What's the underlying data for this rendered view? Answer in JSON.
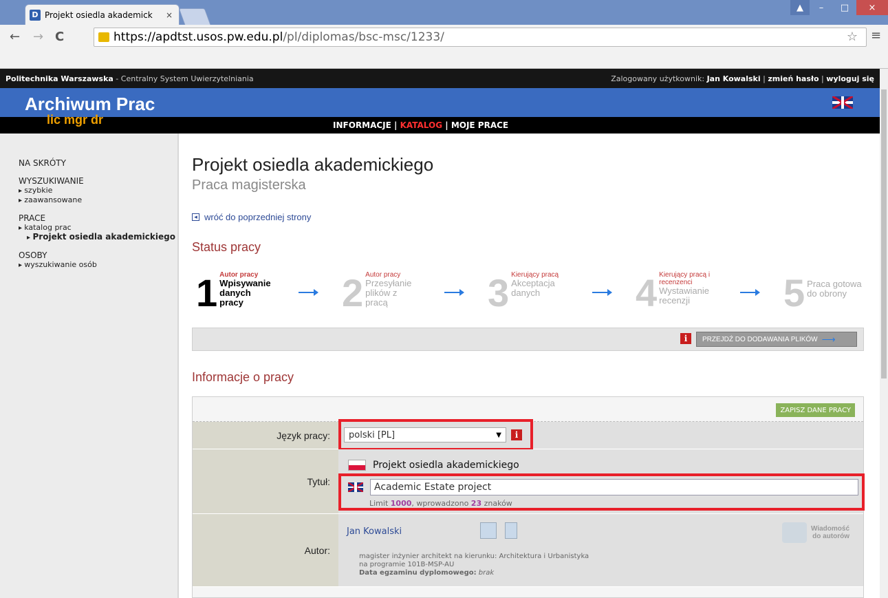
{
  "browser": {
    "tab_title": "Projekt osiedla akademick",
    "tab_close": "×",
    "favicon": "D",
    "url_host": "https://apdtst.usos.pw.edu.pl",
    "url_path": "/pl/diplomas/bsc-msc/1233/",
    "back": "←",
    "forward": "→",
    "reload": "C",
    "star": "☆",
    "menu": "≡",
    "minimize": "–",
    "maximize": "□",
    "close": "×",
    "user": "▲"
  },
  "site": {
    "org": "Politechnika Warszawska",
    "system": " - Centralny System Uwierzytelniania",
    "logged_label": "Zalogowany użytkownik: ",
    "user": "Jan Kowalski",
    "change_pw": "zmień hasło",
    "logout": "wyloguj się",
    "sep": " | ",
    "title": "Archiwum Prac",
    "degrees": "lic mgr dr",
    "nav": {
      "info": "INFORMACJE",
      "catalog": "KATALOG",
      "mine": "MOJE PRACE",
      "sep": " | "
    }
  },
  "sidebar": {
    "shortcuts": "NA SKRÓTY",
    "search": "WYSZUKIWANIE",
    "search_items": [
      "szybkie",
      "zaawansowane"
    ],
    "works": "PRACE",
    "works_items": [
      "katalog prac"
    ],
    "works_sub": "Projekt osiedla akademickiego",
    "people": "OSOBY",
    "people_items": [
      "wyszukiwanie osób"
    ]
  },
  "main": {
    "title": "Projekt osiedla akademickiego",
    "subtitle": "Praca magisterska",
    "back": "wróć do poprzedniej strony",
    "status_title": "Status pracy",
    "info_title": "Informacje o pracy",
    "go_button": "PRZEJDŹ DO DODAWANIA PLIKÓW",
    "info_icon": "i"
  },
  "steps": [
    {
      "num": "1",
      "role": "Autor pracy",
      "act": "Wpisywanie danych pracy",
      "active": true
    },
    {
      "num": "2",
      "role": "Autor pracy",
      "act": "Przesyłanie plików z pracą",
      "active": false
    },
    {
      "num": "3",
      "role": "Kierujący pracą",
      "act": "Akceptacja danych",
      "active": false
    },
    {
      "num": "4",
      "role": "Kierujący pracą i recenzenci",
      "act": "Wystawianie recenzji",
      "active": false
    },
    {
      "num": "5",
      "role": "",
      "act": "Praca gotowa do obrony",
      "active": false
    }
  ],
  "form": {
    "save": "ZAPISZ DANE PRACY",
    "lang_label": "Język pracy:",
    "lang_value": "polski [PL]",
    "title_label": "Tytuł:",
    "title_pl": "Projekt osiedla akademickiego",
    "title_en": "Academic Estate project",
    "limit_pre": "Limit ",
    "limit_max": "1000",
    "limit_mid": ", wprowadzono ",
    "limit_count": "23",
    "limit_post": " znaków",
    "author_label": "Autor:",
    "author_name": "Jan Kowalski",
    "msg_line1": "Wiadomość",
    "msg_line2": "do autorów",
    "author_desc1": "magister inżynier architekt na kierunku: Architektura i Urbanistyka",
    "author_desc2": "na programie 101B-MSP-AU",
    "exam_label": "Data egzaminu dyplomowego:",
    "exam_value": "brak"
  },
  "colors": {
    "banner": "#3a6bc0",
    "accent_red": "#9e3535",
    "degrees": "#f0a000",
    "save_green": "#8ab35a",
    "highlight": "#e8202a"
  }
}
